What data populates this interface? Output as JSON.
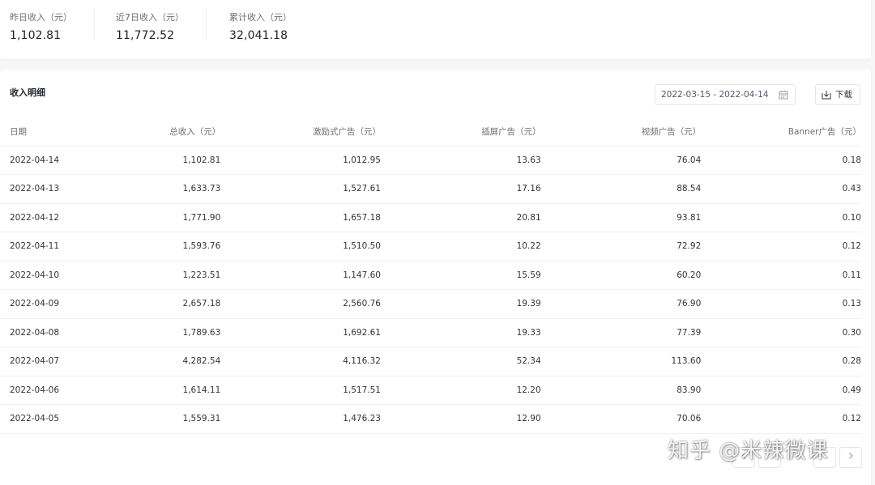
{
  "summary": {
    "yesterday": {
      "label": "昨日收入（元）",
      "value": "1,102.81"
    },
    "last7": {
      "label": "近7日收入（元）",
      "value": "11,772.52"
    },
    "total": {
      "label": "累计收入（元）",
      "value": "32,041.18"
    }
  },
  "detail": {
    "title": "收入明细",
    "date_range": "2022-03-15 - 2022-04-14",
    "download_label": "下载",
    "columns": [
      "日期",
      "总收入（元）",
      "激励式广告（元）",
      "插屏广告（元）",
      "视频广告（元）",
      "Banner广告（元）"
    ],
    "rows": [
      [
        "2022-04-14",
        "1,102.81",
        "1,012.95",
        "13.63",
        "76.04",
        "0.18"
      ],
      [
        "2022-04-13",
        "1,633.73",
        "1,527.61",
        "17.16",
        "88.54",
        "0.43"
      ],
      [
        "2022-04-12",
        "1,771.90",
        "1,657.18",
        "20.81",
        "93.81",
        "0.10"
      ],
      [
        "2022-04-11",
        "1,593.76",
        "1,510.50",
        "10.22",
        "72.92",
        "0.12"
      ],
      [
        "2022-04-10",
        "1,223.51",
        "1,147.60",
        "15.59",
        "60.20",
        "0.11"
      ],
      [
        "2022-04-09",
        "2,657.18",
        "2,560.76",
        "19.39",
        "76.90",
        "0.13"
      ],
      [
        "2022-04-08",
        "1,789.63",
        "1,692.61",
        "19.33",
        "77.39",
        "0.30"
      ],
      [
        "2022-04-07",
        "4,282.54",
        "4,116.32",
        "52.34",
        "113.60",
        "0.28"
      ],
      [
        "2022-04-06",
        "1,614.11",
        "1,517.51",
        "12.20",
        "83.90",
        "0.49"
      ],
      [
        "2022-04-05",
        "1,559.31",
        "1,476.23",
        "12.90",
        "70.06",
        "0.12"
      ]
    ]
  },
  "icons": {
    "calendar": "calendar-icon",
    "download": "download-icon"
  },
  "watermark": "知乎 @米辣微课",
  "colors": {
    "background": "#f5f6f8",
    "card": "#ffffff",
    "border": "#eef0f2",
    "text": "#333333",
    "muted": "#6b6f76"
  }
}
